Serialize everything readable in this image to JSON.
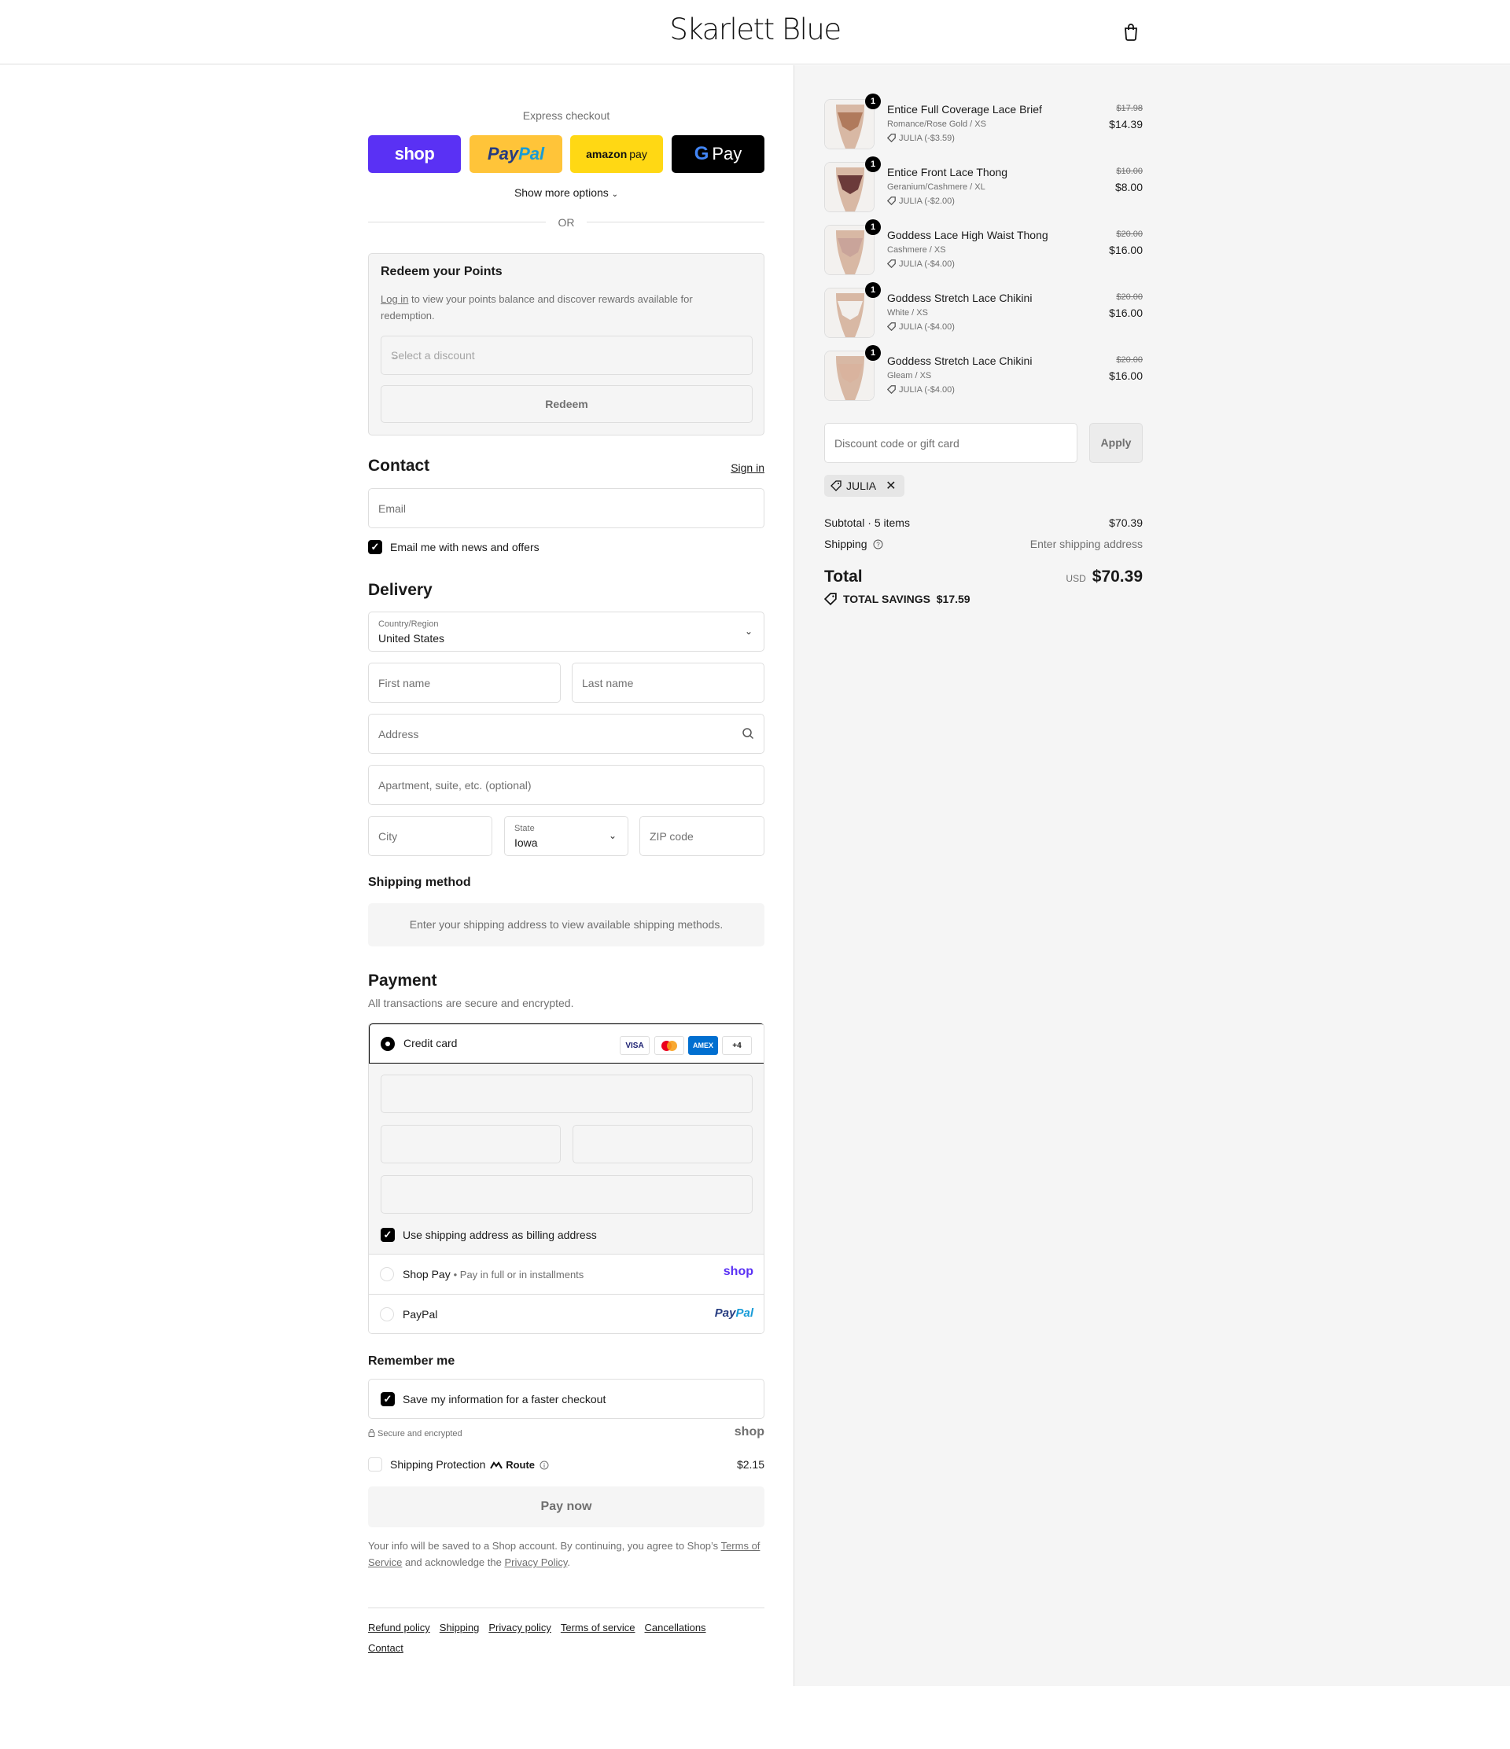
{
  "header": {
    "brand": "Skarlett Blue"
  },
  "express": {
    "title": "Express checkout",
    "shop_label": "shop",
    "paypal_pay": "Pay",
    "paypal_pal": "Pal",
    "amazon_label": "amazon",
    "amazon_pay": "pay",
    "gpay_g": "G",
    "gpay_label": "Pay",
    "show_more": "Show more options",
    "or": "OR"
  },
  "redeem": {
    "title": "Redeem your Points",
    "login_link": "Log in",
    "text": " to view your points balance and discover rewards available for redemption.",
    "select_placeholder": "Select a discount",
    "button": "Redeem"
  },
  "contact": {
    "title": "Contact",
    "sign_in": "Sign in",
    "email_placeholder": "Email",
    "newsletter_label": "Email me with news and offers",
    "newsletter_checked": true
  },
  "delivery": {
    "title": "Delivery",
    "country_label": "Country/Region",
    "country_value": "United States",
    "first_name": "First name",
    "last_name": "Last name",
    "address": "Address",
    "apartment": "Apartment, suite, etc. (optional)",
    "city": "City",
    "state_label": "State",
    "state_value": "Iowa",
    "zip": "ZIP code"
  },
  "shipping_method": {
    "title": "Shipping method",
    "info": "Enter your shipping address to view available shipping methods."
  },
  "payment": {
    "title": "Payment",
    "subtitle": "All transactions are secure and encrypted.",
    "credit_card": "Credit card",
    "card_visa": "VISA",
    "card_amex": "AMEX",
    "card_more": "+4",
    "billing_label": "Use shipping address as billing address",
    "shop_pay": "Shop Pay",
    "shop_pay_sub": "Pay in full or in installments",
    "shop_logo": "shop",
    "paypal": "PayPal",
    "paypal_pay": "Pay",
    "paypal_pal": "Pal"
  },
  "remember": {
    "title": "Remember me",
    "save_label": "Save my information for a faster checkout",
    "secure": "Secure and encrypted",
    "shop_logo": "shop"
  },
  "protection": {
    "label": "Shipping Protection",
    "route": "Route",
    "price": "$2.15"
  },
  "pay_now": "Pay now",
  "legal": {
    "text1": "Your info will be saved to a Shop account. By continuing, you agree to Shop’s ",
    "terms": "Terms of Service",
    "text2": " and acknowledge the ",
    "privacy": "Privacy Policy",
    "text3": "."
  },
  "footer": {
    "links": [
      "Refund policy",
      "Shipping",
      "Privacy policy",
      "Terms of service",
      "Cancellations",
      "Contact"
    ]
  },
  "cart": {
    "items": [
      {
        "qty": "1",
        "name": "Entice Full Coverage Lace Brief",
        "variant": "Romance/Rose Gold / XS",
        "discount": "JULIA (-$3.59)",
        "old_price": "$17.98",
        "price": "$14.39",
        "color": "#b07a5c"
      },
      {
        "qty": "1",
        "name": "Entice Front Lace Thong",
        "variant": "Geranium/Cashmere / XL",
        "discount": "JULIA (-$2.00)",
        "old_price": "$10.00",
        "price": "$8.00",
        "color": "#6b3a3a"
      },
      {
        "qty": "1",
        "name": "Goddess Lace High Waist Thong",
        "variant": "Cashmere / XS",
        "discount": "JULIA (-$4.00)",
        "old_price": "$20.00",
        "price": "$16.00",
        "color": "#c9a49a"
      },
      {
        "qty": "1",
        "name": "Goddess Stretch Lace Chikini",
        "variant": "White / XS",
        "discount": "JULIA (-$4.00)",
        "old_price": "$20.00",
        "price": "$16.00",
        "color": "#f2efec"
      },
      {
        "qty": "1",
        "name": "Goddess Stretch Lace Chikini",
        "variant": "Gleam / XS",
        "discount": "JULIA (-$4.00)",
        "old_price": "$20.00",
        "price": "$16.00",
        "color": "#d9b39e"
      }
    ],
    "discount_placeholder": "Discount code or gift card",
    "apply": "Apply",
    "applied_code": "JULIA",
    "subtotal_label": "Subtotal · 5 items",
    "subtotal_value": "$70.39",
    "shipping_label": "Shipping",
    "shipping_value": "Enter shipping address",
    "total_label": "Total",
    "currency": "USD",
    "total_value": "$70.39",
    "savings_label": "TOTAL SAVINGS",
    "savings_value": "$17.59"
  }
}
